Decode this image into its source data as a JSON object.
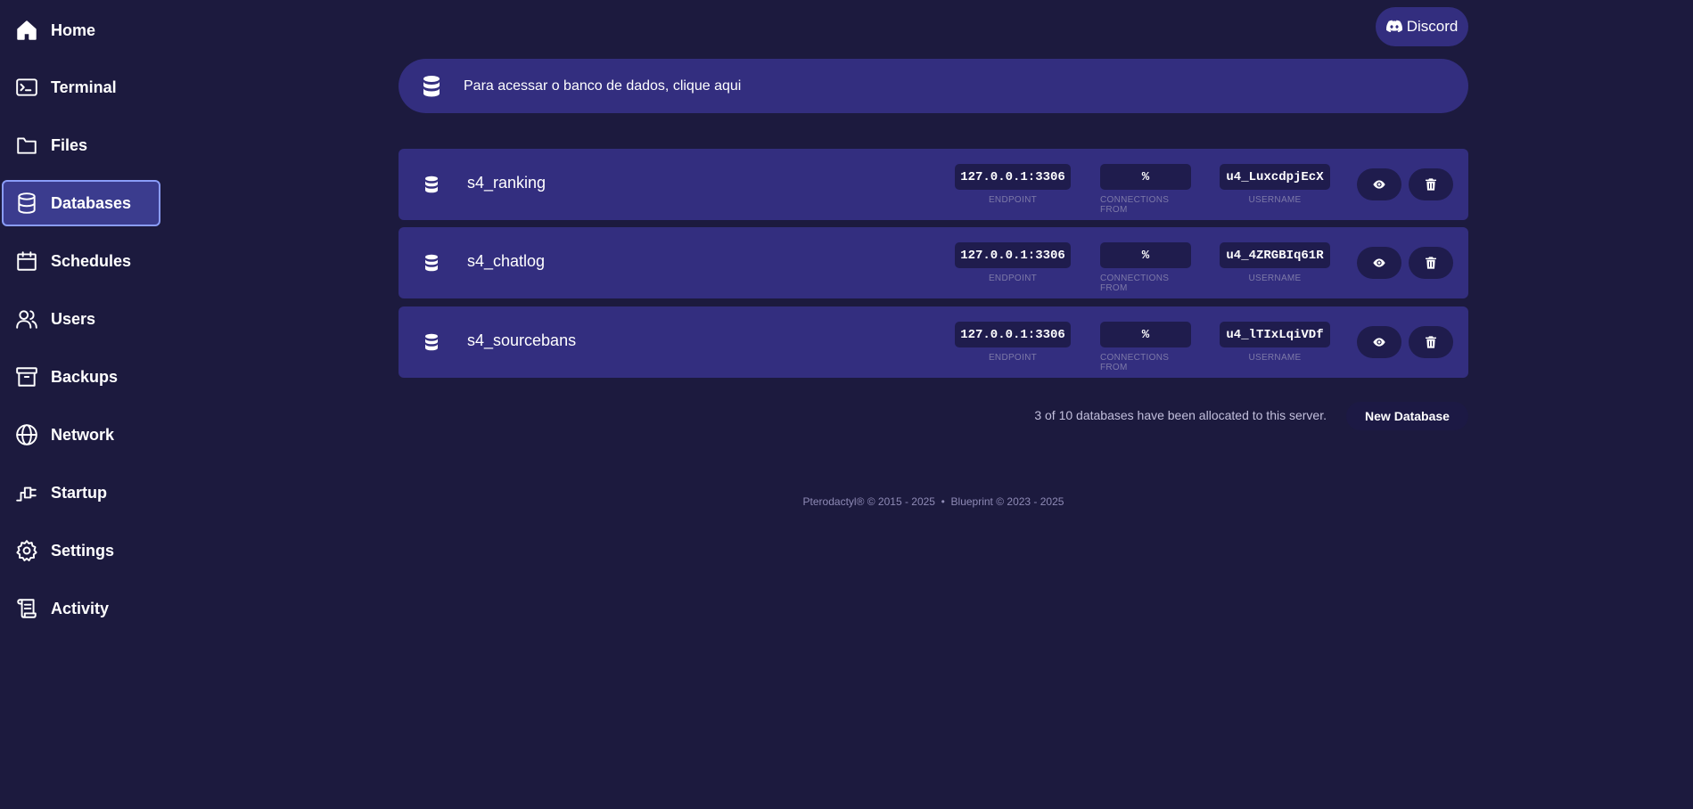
{
  "sidebar": {
    "items": [
      {
        "label": "Home",
        "icon": "home-icon"
      },
      {
        "label": "Terminal",
        "icon": "terminal-icon"
      },
      {
        "label": "Files",
        "icon": "folder-icon"
      },
      {
        "label": "Databases",
        "icon": "database-icon",
        "active": true
      },
      {
        "label": "Schedules",
        "icon": "calendar-icon"
      },
      {
        "label": "Users",
        "icon": "users-icon"
      },
      {
        "label": "Backups",
        "icon": "archive-icon"
      },
      {
        "label": "Network",
        "icon": "globe-icon"
      },
      {
        "label": "Startup",
        "icon": "plug-icon"
      },
      {
        "label": "Settings",
        "icon": "gear-icon"
      },
      {
        "label": "Activity",
        "icon": "scroll-icon"
      }
    ]
  },
  "header": {
    "discord_label": "Discord"
  },
  "banner": {
    "text": "Para acessar o banco de dados, clique aqui"
  },
  "databases": {
    "labels": {
      "endpoint": "Endpoint",
      "connections_from": "Connections from",
      "username": "Username"
    },
    "rows": [
      {
        "name": "s4_ranking",
        "endpoint": "127.0.0.1:3306",
        "connections_from": "%",
        "username": "u4_LuxcdpjEcX"
      },
      {
        "name": "s4_chatlog",
        "endpoint": "127.0.0.1:3306",
        "connections_from": "%",
        "username": "u4_4ZRGBIq61R"
      },
      {
        "name": "s4_sourcebans",
        "endpoint": "127.0.0.1:3306",
        "connections_from": "%",
        "username": "u4_lTIxLqiVDf"
      }
    ],
    "allocation_text": "3 of 10 databases have been allocated to this server.",
    "new_button_label": "New Database"
  },
  "footer": {
    "text": "Pterodactyl® © 2015 - 2025  •  Blueprint © 2023 - 2025"
  },
  "colors": {
    "background": "#1c1a3e",
    "card": "#332e7f",
    "active_nav": "#3b3c8e",
    "active_border": "#8a9cf8"
  }
}
